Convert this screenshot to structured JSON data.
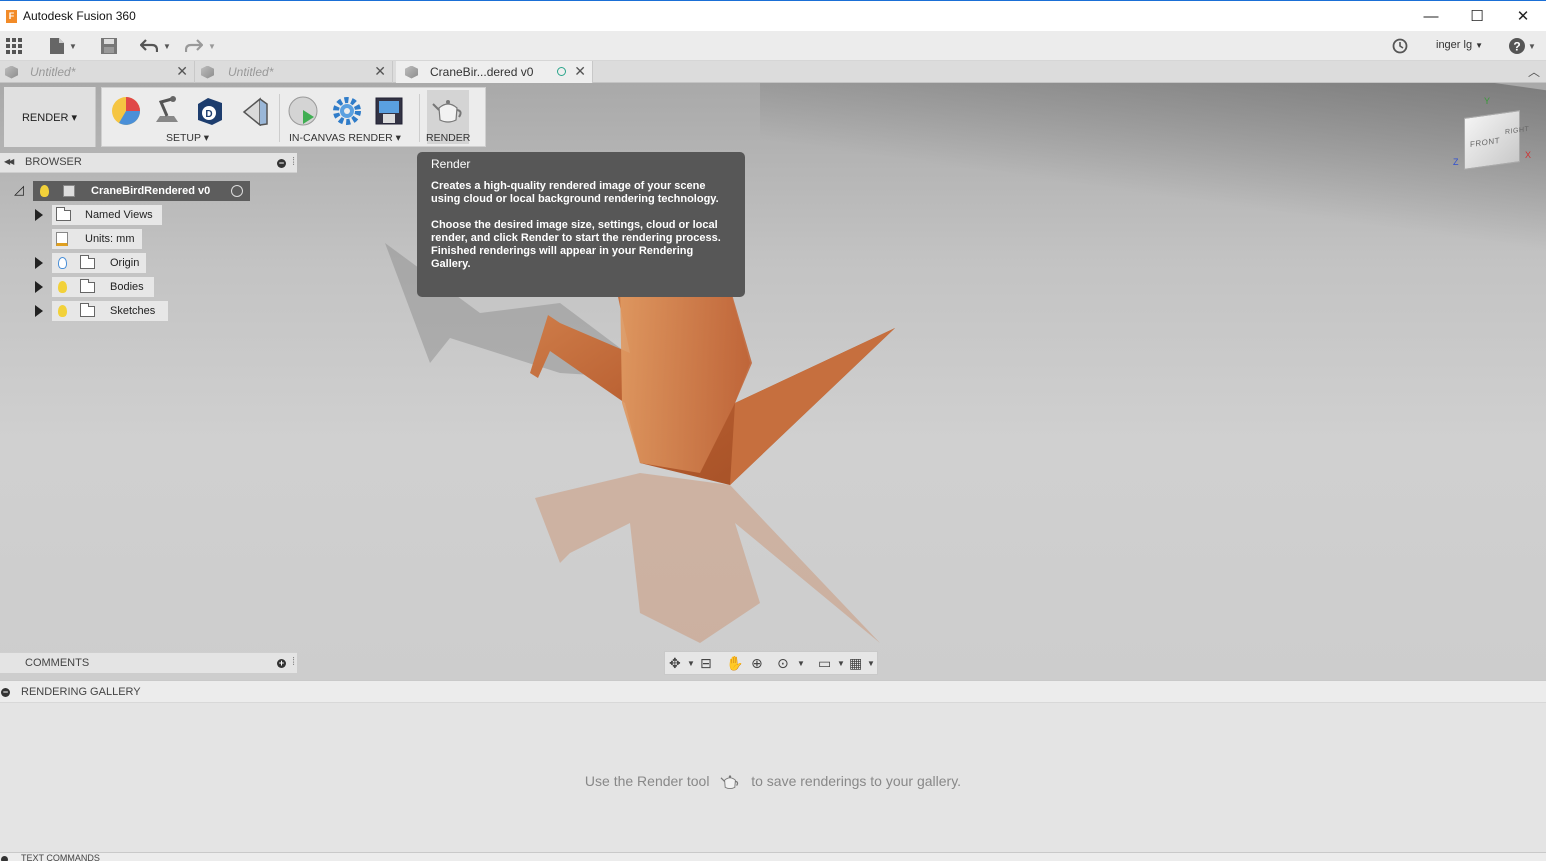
{
  "window": {
    "title": "Autodesk Fusion 360",
    "logo_letter": "F",
    "minimize": "—",
    "maximize": "☐",
    "close": "✕"
  },
  "quick_access": {
    "user": "inger lg"
  },
  "tabs": [
    {
      "label": "Untitled*",
      "active": false
    },
    {
      "label": "Untitled*",
      "active": false
    },
    {
      "label": "CraneBir...dered v0",
      "active": true
    }
  ],
  "ribbon": {
    "workspace": "RENDER ▾",
    "groups": {
      "setup": "SETUP ▾",
      "in_canvas": "IN-CANVAS RENDER ▾",
      "render": "RENDER"
    }
  },
  "browser": {
    "title": "BROWSER",
    "root": "CraneBirdRendered v0",
    "items": [
      {
        "label": "Named Views"
      },
      {
        "label": "Units: mm"
      },
      {
        "label": "Origin"
      },
      {
        "label": "Bodies"
      },
      {
        "label": "Sketches"
      }
    ]
  },
  "comments": {
    "title": "COMMENTS"
  },
  "viewcube": {
    "front": "FRONT",
    "right": "RIGHT",
    "axis_x": "X",
    "axis_y": "Y",
    "axis_z": "Z"
  },
  "tooltip": {
    "title": "Render",
    "para1": "Creates a high-quality rendered image of your scene using cloud or local background rendering technology.",
    "para2": "Choose the desired image size, settings, cloud or local render, and click Render to start the rendering process. Finished renderings will appear in your Rendering Gallery."
  },
  "gallery": {
    "title": "RENDERING GALLERY",
    "msg_before": "Use the Render tool",
    "msg_after": "to save renderings to your gallery."
  },
  "text_commands": {
    "title": "TEXT COMMANDS"
  },
  "icons": [
    "grid-icon",
    "file-icon",
    "save-icon",
    "undo-icon",
    "redo-icon",
    "history-icon",
    "help-icon",
    "appearance-icon",
    "scene-settings-icon",
    "decals-icon",
    "texture-map-icon",
    "in-canvas-render-icon",
    "render-settings-icon",
    "capture-image-icon",
    "render-teapot-icon"
  ],
  "colors": {
    "crane": "#c56a3a",
    "tooltip_bg": "#575757",
    "tree_root_bg": "#5d5d5d"
  }
}
